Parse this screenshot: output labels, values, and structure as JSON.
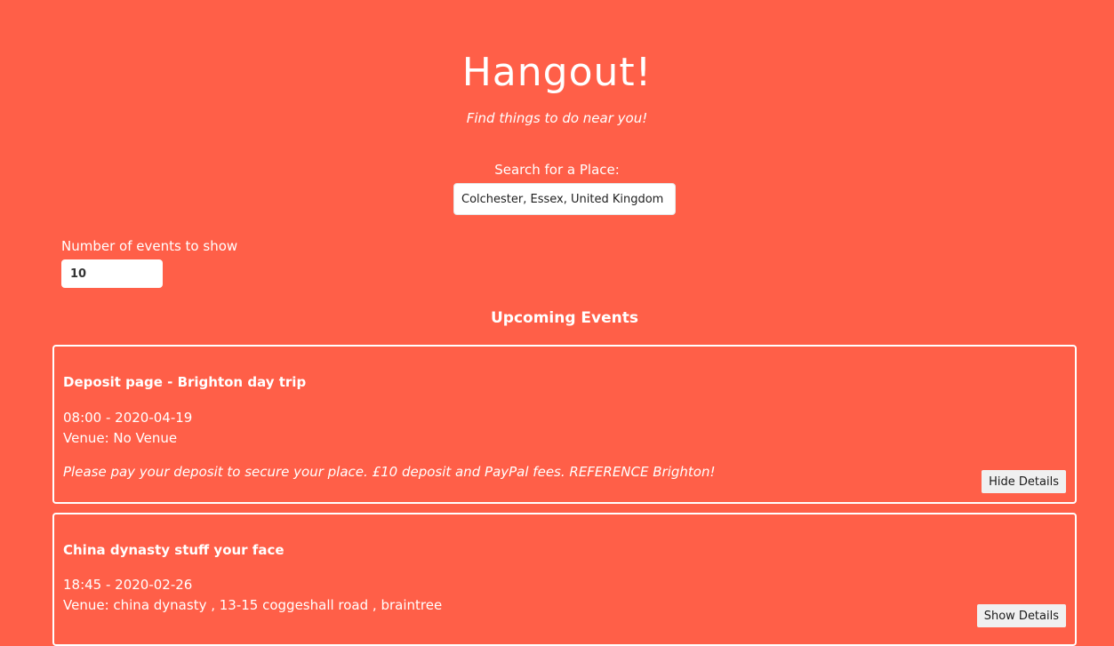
{
  "header": {
    "title": "Hangout!",
    "tagline": "Find things to do near you!"
  },
  "search": {
    "label": "Search for a Place:",
    "value": "Colchester, Essex, United Kingdom"
  },
  "event_count": {
    "label": "Number of events to show",
    "value": "10"
  },
  "events_section": {
    "title": "Upcoming Events"
  },
  "events": [
    {
      "title": "Deposit page - Brighton day trip",
      "time": "08:00 - 2020-04-19",
      "venue": "Venue: No Venue",
      "description": "Please pay your deposit to secure your place. £10 deposit and PayPal fees. REFERENCE Brighton!",
      "button_label": "Hide Details"
    },
    {
      "title": "China dynasty stuff your face",
      "time": "18:45 - 2020-02-26",
      "venue": "Venue: china dynasty , 13-15 coggeshall road , braintree",
      "button_label": "Show Details"
    }
  ],
  "colors": {
    "background": "#ff5f48",
    "text": "#ffffff",
    "button_bg": "#f0f0f0"
  }
}
